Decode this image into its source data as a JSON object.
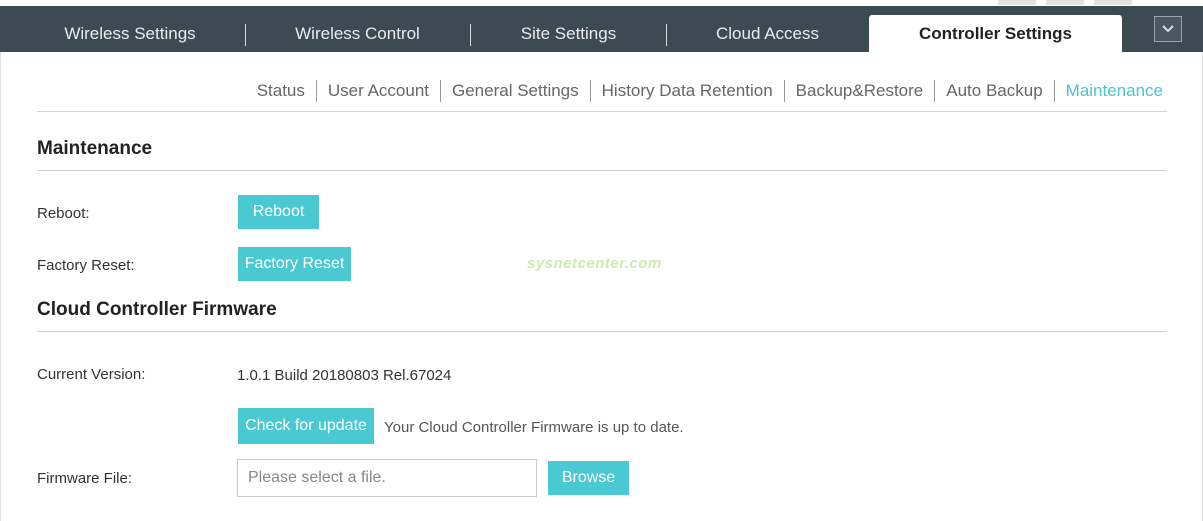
{
  "tabs": [
    {
      "label": "Wireless Settings"
    },
    {
      "label": "Wireless Control"
    },
    {
      "label": "Site Settings"
    },
    {
      "label": "Cloud Access"
    },
    {
      "label": "Controller Settings",
      "active": true
    }
  ],
  "menu_icon": "chevron-down-icon",
  "subnav": [
    {
      "label": "Status"
    },
    {
      "label": "User Account"
    },
    {
      "label": "General Settings"
    },
    {
      "label": "History Data Retention"
    },
    {
      "label": "Backup&Restore"
    },
    {
      "label": "Auto Backup"
    },
    {
      "label": "Maintenance",
      "active": true
    }
  ],
  "maintenance": {
    "title": "Maintenance",
    "reboot_label": "Reboot:",
    "reboot_button": "Reboot",
    "factory_reset_label": "Factory Reset:",
    "factory_reset_button": "Factory Reset"
  },
  "firmware": {
    "title": "Cloud Controller Firmware",
    "current_version_label": "Current Version:",
    "current_version_value": "1.0.1 Build 20180803 Rel.67024",
    "check_button": "Check for update",
    "status_note": "Your Cloud Controller Firmware is up to date.",
    "file_label": "Firmware File:",
    "file_placeholder": "Please select a file.",
    "browse_button": "Browse"
  },
  "watermark": "sysnetcenter.com",
  "colors": {
    "tabbar_bg": "#3d4a52",
    "accent": "#4ac9d3",
    "active_subnav": "#4ec3cf"
  }
}
